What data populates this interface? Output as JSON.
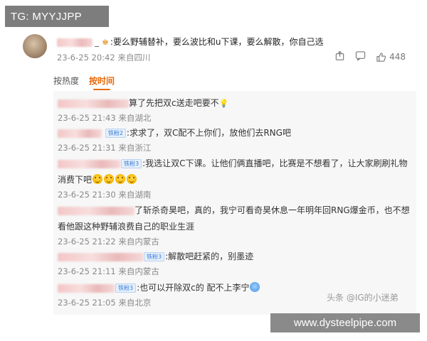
{
  "watermark": {
    "tg": "TG: MYYJJPP",
    "handle": "头条 @IG的小迷弟",
    "site": "www.dysteelpipe.com"
  },
  "main_comment": {
    "separator": "_",
    "text": ":要么野辅替补，要么波比和u下课，要么解散，你自己选",
    "time": "23-6-25 20:42 来自四川",
    "likes": "448",
    "icons": [
      "share-icon",
      "comment-icon",
      "like-icon"
    ]
  },
  "sort_tabs": {
    "hot": "按热度",
    "time": "按时间"
  },
  "replies": [
    {
      "text": "算了先把双c送走吧要不",
      "time": "23-6-25 21:43 来自湖北"
    },
    {
      "badge": "铁粉2",
      "text": ":求求了，双C配不上你们，放他们去RNG吧",
      "time": "23-6-25 21:31 来自浙江"
    },
    {
      "badge": "铁粉3",
      "text": ":我选让双C下课。让他们俩直播吧，比赛是不想看了，让大家刷刷礼物消费下吧",
      "time": "23-6-25 21:30 来自湖南"
    },
    {
      "text": "了斩杀奇昊吧，真的，我宁可看奇昊休息一年明年回RNG爆金币，也不想看他跟这种野辅浪费自己的职业生涯",
      "time": "23-6-25 21:22 来自内蒙古"
    },
    {
      "badge": "铁粉3",
      "text": ":解散吧赶紧的，别墨迹",
      "time": "23-6-25 21:11 来自内蒙古"
    },
    {
      "badge": "铁粉3",
      "text": ":也可以开除双c的   配不上李宁",
      "time": "23-6-25 21:05 来自北京"
    }
  ]
}
